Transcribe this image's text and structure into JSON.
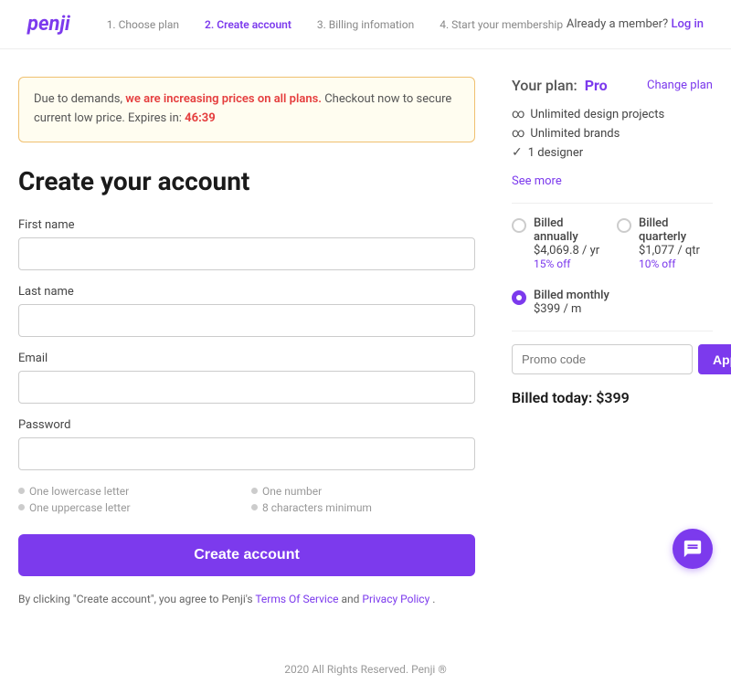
{
  "header": {
    "logo": "penji",
    "steps": [
      {
        "id": "step1",
        "label": "1. Choose plan",
        "active": false
      },
      {
        "id": "step2",
        "label": "2. Create account",
        "active": true
      },
      {
        "id": "step3",
        "label": "3. Billing infomation",
        "active": false
      },
      {
        "id": "step4",
        "label": "4. Start your membership",
        "active": false
      }
    ],
    "already_member_text": "Already a member?",
    "log_in_label": "Log in"
  },
  "notice": {
    "text_before": "Due to demands,",
    "highlight": "we are increasing prices on all plans.",
    "text_after": "Checkout now to secure current low price.",
    "expires_label": "Expires in:",
    "timer": "46:39"
  },
  "form": {
    "title": "Create your account",
    "first_name_label": "First name",
    "last_name_label": "Last name",
    "email_label": "Email",
    "password_label": "Password",
    "hints": [
      {
        "id": "hint1",
        "text": "One lowercase letter"
      },
      {
        "id": "hint2",
        "text": "One number"
      },
      {
        "id": "hint3",
        "text": "One uppercase letter"
      },
      {
        "id": "hint4",
        "text": "8 characters minimum"
      }
    ],
    "create_btn_label": "Create account",
    "terms_text_before": "By clicking \"Create account\", you agree to Penji's",
    "terms_label": "Terms Of Service",
    "terms_and": "and",
    "privacy_label": "Privacy Policy",
    "terms_end": "."
  },
  "plan": {
    "label": "Your plan:",
    "name": "Pro",
    "change_label": "Change plan",
    "features": [
      {
        "icon": "infinity",
        "text": "Unlimited design projects"
      },
      {
        "icon": "infinity",
        "text": "Unlimited brands"
      },
      {
        "icon": "check",
        "text": "1 designer"
      }
    ],
    "see_more_label": "See more",
    "billing_options": [
      {
        "id": "annual",
        "label": "Billed annually",
        "price": "$4,069.8 / yr",
        "discount": "15% off",
        "selected": false
      },
      {
        "id": "quarterly",
        "label": "Billed quarterly",
        "price": "$1,077 / qtr",
        "discount": "10% off",
        "selected": false
      },
      {
        "id": "monthly",
        "label": "Billed monthly",
        "price": "$399 / m",
        "discount": "",
        "selected": true
      }
    ],
    "promo_placeholder": "Promo code",
    "apply_label": "Apply",
    "billed_today_label": "Billed today:",
    "billed_today_amount": "$399"
  },
  "footer": {
    "text": "2020 All Rights Reserved. Penji ®"
  }
}
